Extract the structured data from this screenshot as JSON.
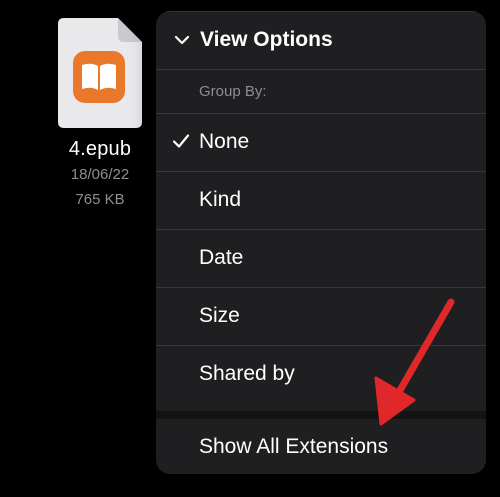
{
  "file": {
    "name": "4.epub",
    "date": "18/06/22",
    "size": "765 KB",
    "icon": "book-icon"
  },
  "menu": {
    "header_label": "View Options",
    "header_icon": "chevron-down-icon",
    "group_by_label": "Group By:",
    "options": [
      {
        "label": "None",
        "checked": true
      },
      {
        "label": "Kind",
        "checked": false
      },
      {
        "label": "Date",
        "checked": false
      },
      {
        "label": "Size",
        "checked": false
      },
      {
        "label": "Shared by",
        "checked": false
      }
    ],
    "extensions_label": "Show All Extensions"
  },
  "colors": {
    "background": "#000000",
    "menu_bg": "#1f1f21",
    "secondary_text": "#8d8d93",
    "book_orange": "#e9782a",
    "annotation_arrow": "#e0282a"
  }
}
